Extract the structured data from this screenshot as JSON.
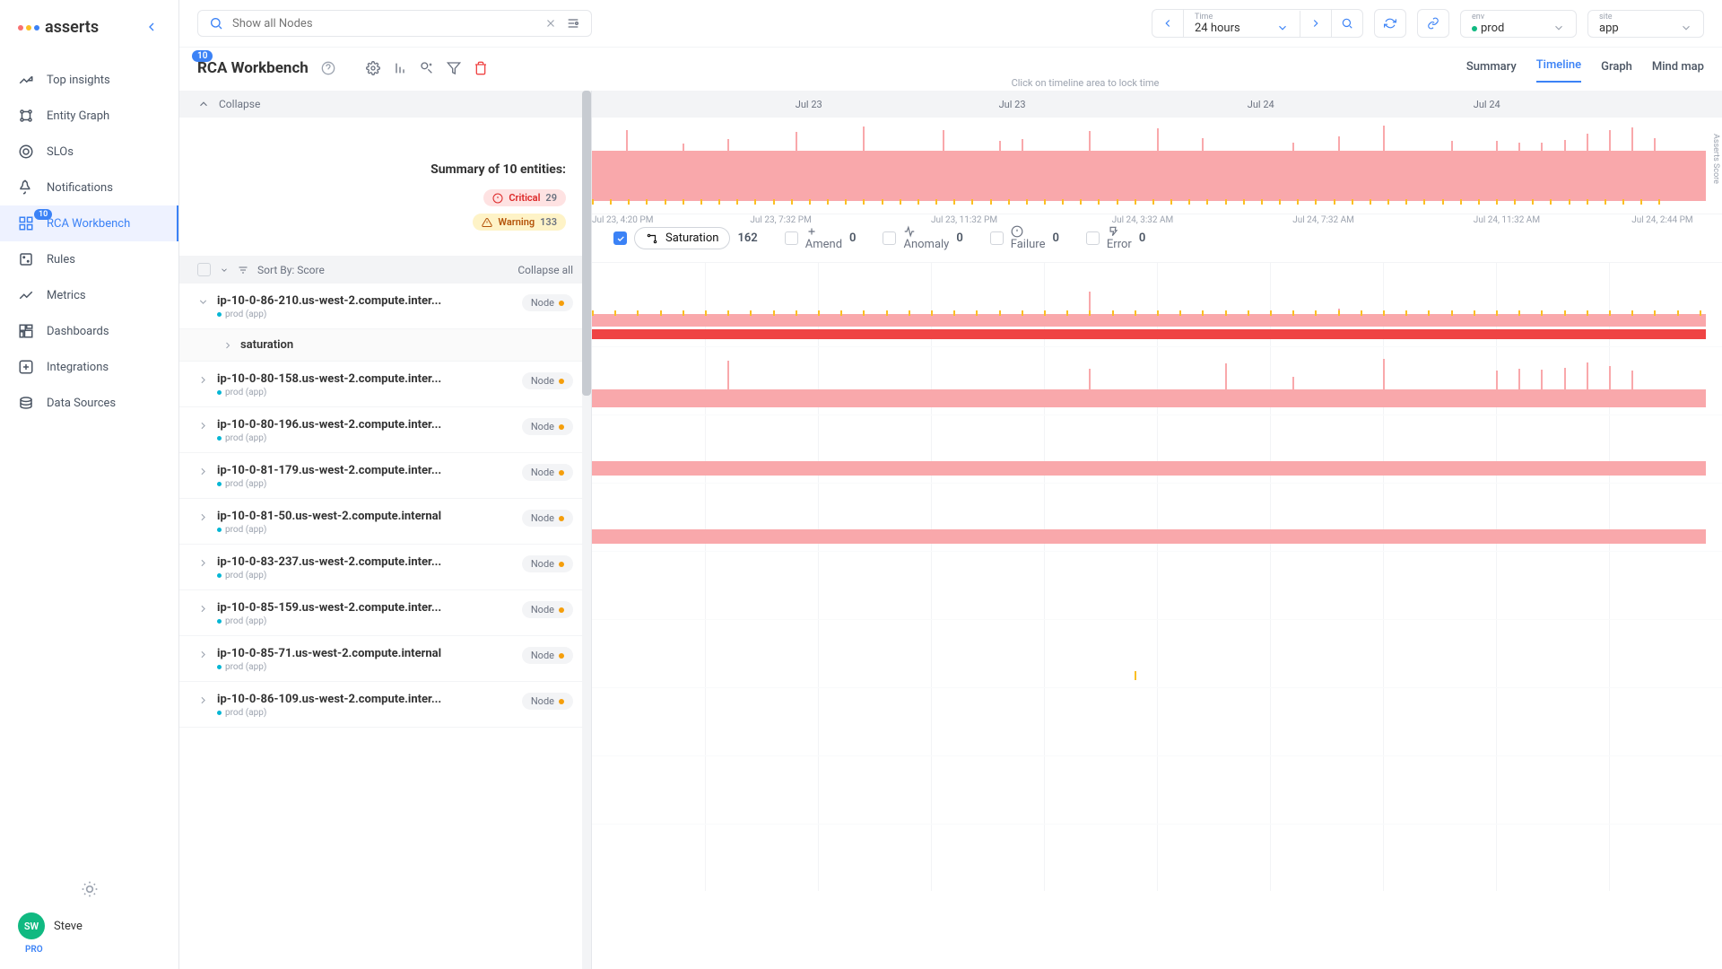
{
  "logo": "asserts",
  "search": {
    "placeholder": "Show all Nodes"
  },
  "sidebar": {
    "items": [
      {
        "label": "Top insights"
      },
      {
        "label": "Entity Graph"
      },
      {
        "label": "SLOs"
      },
      {
        "label": "Notifications"
      },
      {
        "label": "RCA Workbench",
        "badge": "10",
        "active": true
      },
      {
        "label": "Rules"
      },
      {
        "label": "Metrics"
      },
      {
        "label": "Dashboards"
      },
      {
        "label": "Integrations"
      },
      {
        "label": "Data Sources"
      }
    ]
  },
  "user": {
    "initials": "SW",
    "name": "Steve",
    "badge": "PRO"
  },
  "time": {
    "label": "Time",
    "value": "24 hours"
  },
  "env": {
    "label": "env",
    "value": "prod"
  },
  "site": {
    "label": "site",
    "value": "app"
  },
  "page": {
    "title": "RCA Workbench",
    "badge": "10"
  },
  "tabs": [
    "Summary",
    "Timeline",
    "Graph",
    "Mind map"
  ],
  "active_tab": "Timeline",
  "hint": "Click on timeline area to lock time",
  "collapse_label": "Collapse",
  "summary": {
    "title": "Summary of 10 entities:",
    "critical": {
      "label": "Critical",
      "count": "29"
    },
    "warning": {
      "label": "Warning",
      "count": "133"
    }
  },
  "sort": {
    "label": "Sort By: Score",
    "collapse_all": "Collapse all"
  },
  "timeline_dates": [
    "Jul 23",
    "Jul 23",
    "Jul 24",
    "Jul 24"
  ],
  "xaxis": [
    "Jul 23, 4:20 PM",
    "Jul 23, 7:32 PM",
    "Jul 23, 11:32 PM",
    "Jul 24, 3:32 AM",
    "Jul 24, 7:32 AM",
    "Jul 24, 11:32 AM",
    "Jul 24, 2:44 PM"
  ],
  "asserts_score_label": "Asserts Score",
  "filters": [
    {
      "name": "Saturation",
      "count": "162",
      "checked": true
    },
    {
      "name": "Amend",
      "count": "0"
    },
    {
      "name": "Anomaly",
      "count": "0"
    },
    {
      "name": "Failure",
      "count": "0"
    },
    {
      "name": "Error",
      "count": "0"
    }
  ],
  "node_label": "Node",
  "saturation_label": "saturation",
  "prod_app": "prod (app)",
  "entities": [
    {
      "name": "ip-10-0-86-210.us-west-2.compute.inter...",
      "expanded": true
    },
    {
      "name": "ip-10-0-80-158.us-west-2.compute.inter..."
    },
    {
      "name": "ip-10-0-80-196.us-west-2.compute.inter..."
    },
    {
      "name": "ip-10-0-81-179.us-west-2.compute.inter..."
    },
    {
      "name": "ip-10-0-81-50.us-west-2.compute.internal"
    },
    {
      "name": "ip-10-0-83-237.us-west-2.compute.inter..."
    },
    {
      "name": "ip-10-0-85-159.us-west-2.compute.inter..."
    },
    {
      "name": "ip-10-0-85-71.us-west-2.compute.internal"
    },
    {
      "name": "ip-10-0-86-109.us-west-2.compute.inter..."
    }
  ]
}
